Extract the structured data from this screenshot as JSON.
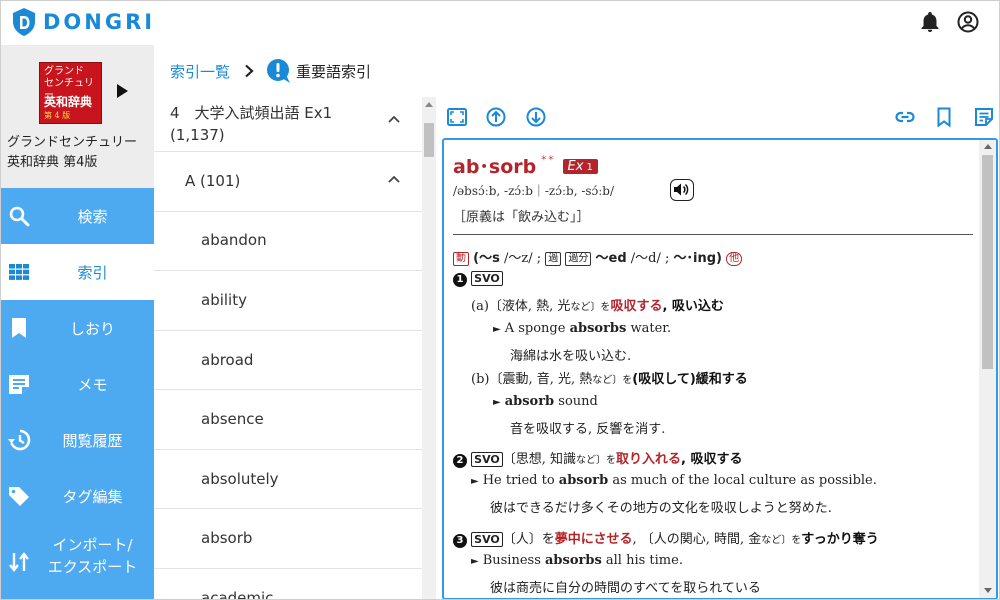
{
  "app": {
    "logo_text": "DONGRI",
    "colors": {
      "accent": "#1a8ad8",
      "sidebar": "#4daaf0",
      "headword": "#b4252b"
    }
  },
  "header": {
    "icons": [
      "bell-icon",
      "account-icon"
    ]
  },
  "book": {
    "cover_line1": "グランド",
    "cover_line2": "センチュリー",
    "cover_line3": "英和辞典",
    "cover_edition": "第 4 版",
    "title_line1": "グランドセンチュリー",
    "title_line2": "英和辞典 第4版"
  },
  "nav": {
    "items": [
      {
        "label": "検索",
        "icon": "search-icon",
        "active": false
      },
      {
        "label": "索引",
        "icon": "grid-icon",
        "active": true
      },
      {
        "label": "しおり",
        "icon": "bookmark-icon",
        "active": false
      },
      {
        "label": "メモ",
        "icon": "memo-icon",
        "active": false
      },
      {
        "label": "閲覧履歴",
        "icon": "history-icon",
        "active": false
      },
      {
        "label": "タグ編集",
        "icon": "tag-icon",
        "active": false
      },
      {
        "label_line1": "インポート/",
        "label_line2": "エクスポート",
        "icon": "import-export-icon",
        "active": false
      }
    ]
  },
  "breadcrumb": {
    "index_label": "索引一覧",
    "current_label": "重要語索引"
  },
  "index_list": {
    "section_title_line1": "4　大学入試頻出語 Ex1",
    "section_title_line2": "(1,137)",
    "group_label": "A (101)",
    "words": [
      "abandon",
      "ability",
      "abroad",
      "absence",
      "absolutely",
      "absorb",
      "academic"
    ]
  },
  "entry": {
    "headword": "ab･sorb",
    "stars": "＊＊",
    "badge_label": "Ex",
    "badge_num": "1",
    "pronunciation": "/əbsɔ́ːb, ‐zɔ́ːb｜‐zɔ́ːb, ‐sɔ́ːb/",
    "etymology": "［原義は「飲み込む」］",
    "pos_mark": "動",
    "inflection_1": "(～s",
    "inflection_1_note": "/～z/ ;",
    "past_mark": "過",
    "pp_mark": "過分",
    "inflection_2": "～ed",
    "inflection_2_note": "/～d/ ;",
    "inflection_3": "～･ing)",
    "trans_mark": "他",
    "senses": [
      {
        "num": "1",
        "pattern": "SVO",
        "subs": [
          {
            "letter": "(a)",
            "objects": "〔液体, 熱, 光",
            "objects_note": "など",
            "objects_end": "〕を",
            "gloss_red": "吸収する",
            "gloss_rest": ", 吸い込む",
            "example_pre": "A sponge ",
            "example_bold": "absorbs",
            "example_post": " water.",
            "translation": "海綿は水を吸い込む."
          },
          {
            "letter": "(b)",
            "objects": "〔震動, 音, 光, 熱",
            "objects_note": "など",
            "objects_end": "〕を",
            "gloss_red": "",
            "gloss_rest": "(吸収して)緩和する",
            "example_pre": "",
            "example_bold": "absorb",
            "example_post": " sound",
            "translation": "音を吸収する, 反響を消す."
          }
        ]
      },
      {
        "num": "2",
        "pattern": "SVO",
        "objects": "〔思想, 知識",
        "objects_note": "など",
        "objects_end": "〕を",
        "gloss_red": "取り入れる",
        "gloss_rest": ", 吸収する",
        "example_pre": "He tried to ",
        "example_bold": "absorb",
        "example_post": " as much of the local culture as possible.",
        "translation": "彼はできるだけ多くその地方の文化を吸収しようと努めた."
      },
      {
        "num": "3",
        "pattern": "SVO",
        "objects": "〔人〕を",
        "gloss_red": "夢中にさせる",
        "gloss_mid": ", 〔人の関心, 時間, 金",
        "gloss_mid_note": "など",
        "gloss_end": "〕を",
        "gloss_rest": "すっかり奪う",
        "example_pre": "Business ",
        "example_bold": "absorbs",
        "example_post": " all his time.",
        "translation": "彼は商売に自分の時間のすべてを取られている"
      }
    ]
  }
}
